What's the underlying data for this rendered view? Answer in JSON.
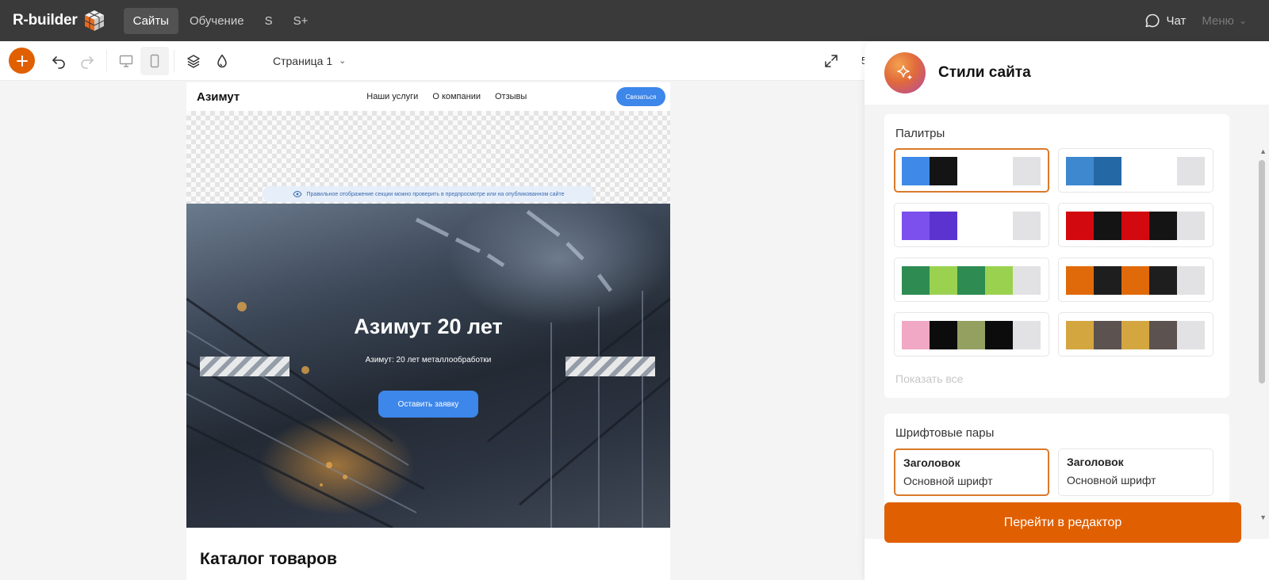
{
  "topbar": {
    "logo_text": "R-builder",
    "nav": [
      {
        "label": "Сайты",
        "active": true
      },
      {
        "label": "Обучение",
        "active": false
      },
      {
        "label": "S",
        "active": false
      },
      {
        "label": "S+",
        "active": false
      }
    ],
    "chat_label": "Чат",
    "menu_label": "Меню"
  },
  "toolbar": {
    "add_icon": "plus-icon",
    "page_select": "Страница 1",
    "zoom_partial": "5"
  },
  "site": {
    "brand": "Азимут",
    "nav": [
      "Наши услуги",
      "О компании",
      "Отзывы"
    ],
    "cta": "Связаться",
    "preview_note": "Правильное отображение секции можно проверить в предпросмотре или на опубликованном сайте",
    "hero_title": "Азимут 20 лет",
    "hero_subtitle": "Азимут: 20 лет металлообработки",
    "hero_button": "Оставить заявку",
    "catalog_title": "Каталог товаров"
  },
  "panel": {
    "title": "Стили сайта",
    "palettes_title": "Палитры",
    "palettes": [
      {
        "colors": [
          "#3f8ae8",
          "#141414",
          "#ffffff",
          "#ffffff",
          "#e2e2e4"
        ],
        "selected": true
      },
      {
        "colors": [
          "#3d88cf",
          "#2469a6",
          "#ffffff",
          "#ffffff",
          "#e2e2e4"
        ],
        "selected": false
      },
      {
        "colors": [
          "#7b50ec",
          "#5b34cf",
          "#ffffff",
          "#ffffff",
          "#e2e2e4"
        ],
        "selected": false
      },
      {
        "colors": [
          "#d20a0f",
          "#141414",
          "#d20a0f",
          "#141414",
          "#e2e2e4"
        ],
        "selected": false
      },
      {
        "colors": [
          "#2e8c53",
          "#9ad24f",
          "#2e8c53",
          "#9ad24f",
          "#e2e2e4"
        ],
        "selected": false
      },
      {
        "colors": [
          "#e06a09",
          "#1e1e1e",
          "#e06a09",
          "#1e1e1e",
          "#e2e2e4"
        ],
        "selected": false
      },
      {
        "colors": [
          "#f0a8c4",
          "#0c0c0c",
          "#93a060",
          "#0c0c0c",
          "#e2e2e4"
        ],
        "selected": false
      },
      {
        "colors": [
          "#d4a640",
          "#5c524f",
          "#d4a640",
          "#5c524f",
          "#e2e2e4"
        ],
        "selected": false
      }
    ],
    "show_all": "Показать все",
    "fonts_title": "Шрифтовые пары",
    "font_pairs": [
      {
        "heading": "Заголовок",
        "body": "Основной шрифт",
        "selected": true
      },
      {
        "heading": "Заголовок",
        "body": "Основной шрифт",
        "selected": false
      }
    ],
    "go_editor": "Перейти в редактор"
  }
}
